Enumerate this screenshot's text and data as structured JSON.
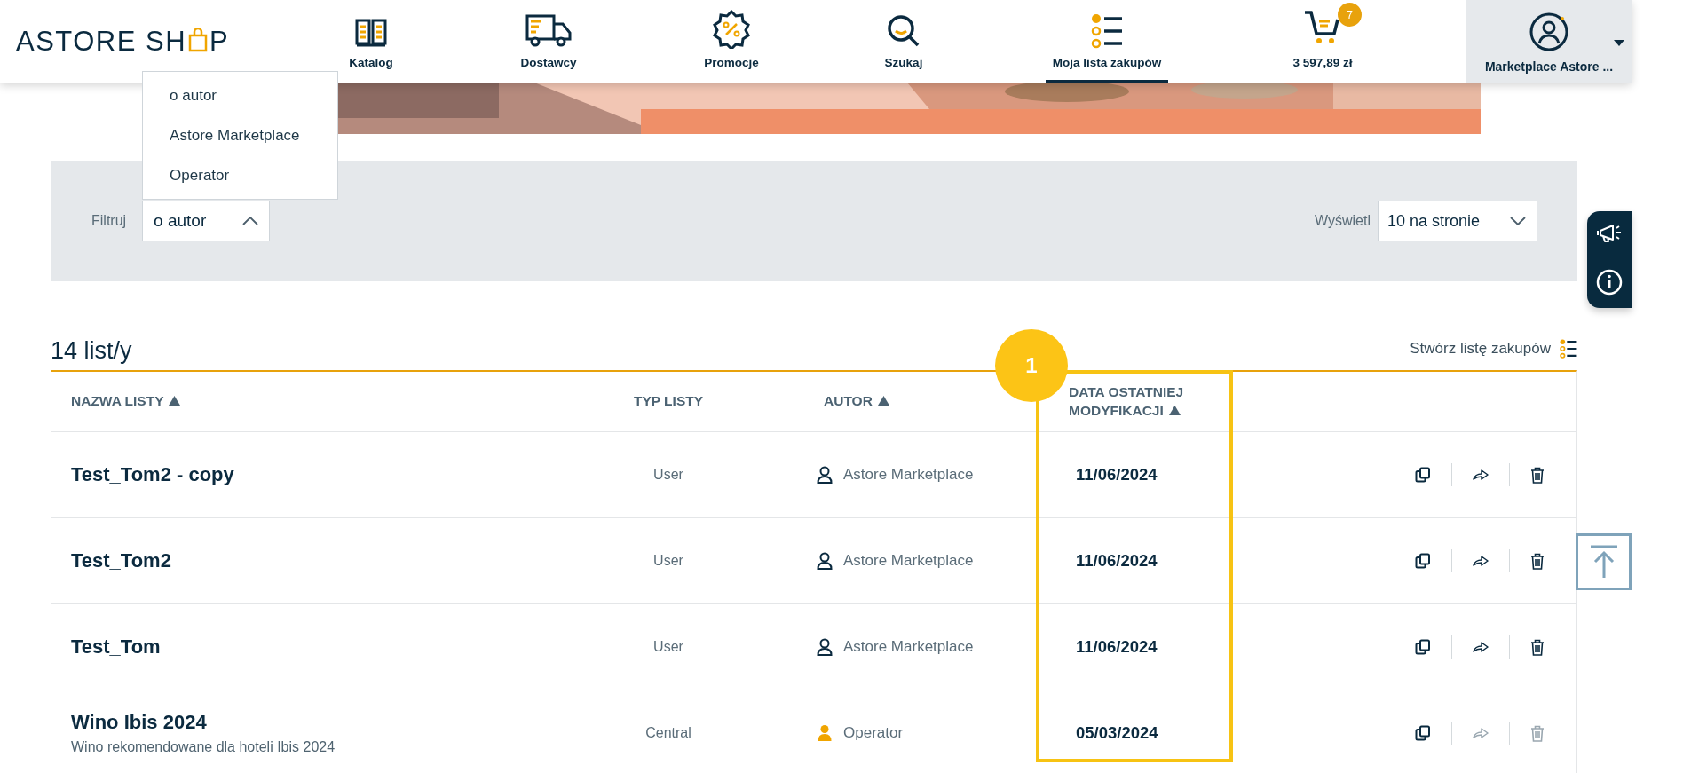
{
  "header": {
    "logo": {
      "before": "ASTORE SH",
      "after": "P"
    },
    "nav": [
      {
        "label": "Katalog",
        "selected": false
      },
      {
        "label": "Dostawcy",
        "selected": false
      },
      {
        "label": "Promocje",
        "selected": false
      },
      {
        "label": "Szukaj",
        "selected": false
      },
      {
        "label": "Moja lista zakupów",
        "selected": true
      }
    ],
    "cart": {
      "badge": "7",
      "total": "3 597,89 zł"
    },
    "account": {
      "name": "Marketplace Astore ..."
    }
  },
  "filter": {
    "label": "Filtruj",
    "value": "o autor",
    "expanded": true,
    "options": [
      "o autor",
      "Astore Marketplace",
      "Operator"
    ]
  },
  "per_page": {
    "label": "Wyświetl",
    "value": "10 na stronie"
  },
  "count_title": "14 list/y",
  "create_link": "Stwórz listę zakupów",
  "table": {
    "columns": [
      {
        "label": "NAZWA LISTY",
        "sorted": true
      },
      {
        "label": "TYP LISTY",
        "sorted": false
      },
      {
        "label": "AUTOR",
        "sorted": true
      },
      {
        "label": "DATA OSTATNIEJ MODYFIKACJI",
        "sorted": true
      }
    ],
    "rows": [
      {
        "name": "Test_Tom2 - copy",
        "type": "User",
        "author": "Astore Marketplace",
        "kind": "user",
        "date": "11/06/2024",
        "actions_disabled": false
      },
      {
        "name": "Test_Tom2",
        "type": "User",
        "author": "Astore Marketplace",
        "kind": "user",
        "date": "11/06/2024",
        "actions_disabled": false
      },
      {
        "name": "Test_Tom",
        "type": "User",
        "author": "Astore Marketplace",
        "kind": "user",
        "date": "11/06/2024",
        "actions_disabled": false
      },
      {
        "name": "Wino Ibis 2024",
        "description": "Wino rekomendowane dla hoteli Ibis 2024",
        "type": "Central",
        "author": "Operator",
        "kind": "operator",
        "date": "05/03/2024",
        "actions_disabled": true
      }
    ]
  },
  "annotation": {
    "label": "1"
  }
}
